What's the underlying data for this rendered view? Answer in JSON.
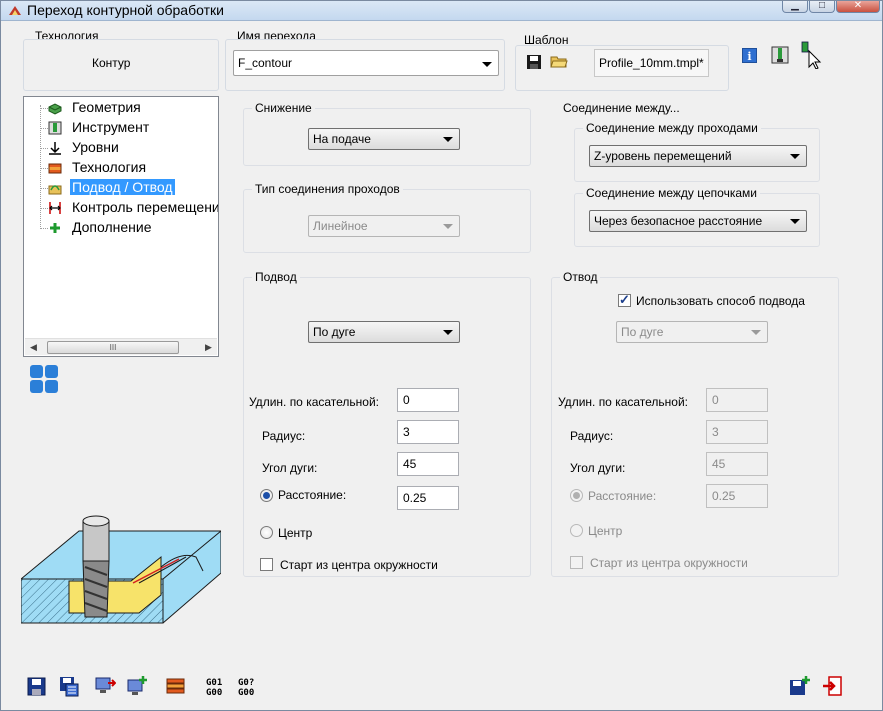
{
  "window": {
    "title": "Переход контурной обработки"
  },
  "header": {
    "technology": {
      "label": "Технология",
      "value": "Контур"
    },
    "step_name": {
      "label": "Имя перехода",
      "value": "F_contour"
    },
    "template": {
      "label": "Шаблон",
      "value": "Profile_10mm.tmpl*"
    }
  },
  "tree": {
    "items": [
      {
        "label": "Геометрия",
        "icon": "geometry-icon"
      },
      {
        "label": "Инструмент",
        "icon": "tool-icon"
      },
      {
        "label": "Уровни",
        "icon": "levels-icon"
      },
      {
        "label": "Технология",
        "icon": "technology-icon"
      },
      {
        "label": "Подвод / Отвод",
        "icon": "approach-retract-icon"
      },
      {
        "label": "Контроль перемещений",
        "icon": "movement-control-icon"
      },
      {
        "label": "Дополнение",
        "icon": "addition-icon"
      }
    ],
    "selected_index": 4
  },
  "descent": {
    "legend": "Снижение",
    "value": "На подаче"
  },
  "pass_connection_type": {
    "legend": "Тип соединения проходов",
    "value": "Линейное"
  },
  "connection": {
    "legend": "Соединение между...",
    "between_passes": {
      "legend": "Соединение между проходами",
      "value": "Z-уровень перемещений"
    },
    "between_chains": {
      "legend": "Соединение между цепочками",
      "value": "Через безопасное расстояние"
    }
  },
  "approach": {
    "legend": "Подвод",
    "method": "По дуге",
    "tangent_ext_label": "Удлин. по касательной:",
    "tangent_ext_value": "0",
    "radius_label": "Радиус:",
    "radius_value": "3",
    "arc_angle_label": "Угол дуги:",
    "arc_angle_value": "45",
    "distance_label": "Расстояние:",
    "distance_value": "0.25",
    "center_label": "Центр",
    "start_center_label": "Старт из центра окружности"
  },
  "retract": {
    "legend": "Отвод",
    "use_approach_label": "Использовать способ подвода",
    "use_approach_checked": true,
    "method": "По дуге",
    "tangent_ext_label": "Удлин. по касательной:",
    "tangent_ext_value": "0",
    "radius_label": "Радиус:",
    "radius_value": "3",
    "arc_angle_label": "Угол дуги:",
    "arc_angle_value": "45",
    "distance_label": "Расстояние:",
    "distance_value": "0.25",
    "center_label": "Центр",
    "start_center_label": "Старт из центра окружности"
  },
  "scrollbar": {
    "thumb_glyph": "III"
  },
  "toolbar": {
    "gcode_a": "G01\nG00",
    "gcode_b": "G0?\nG00"
  },
  "colors": {
    "selection": "#3399ff",
    "titlebar": "#c4d8ef"
  }
}
